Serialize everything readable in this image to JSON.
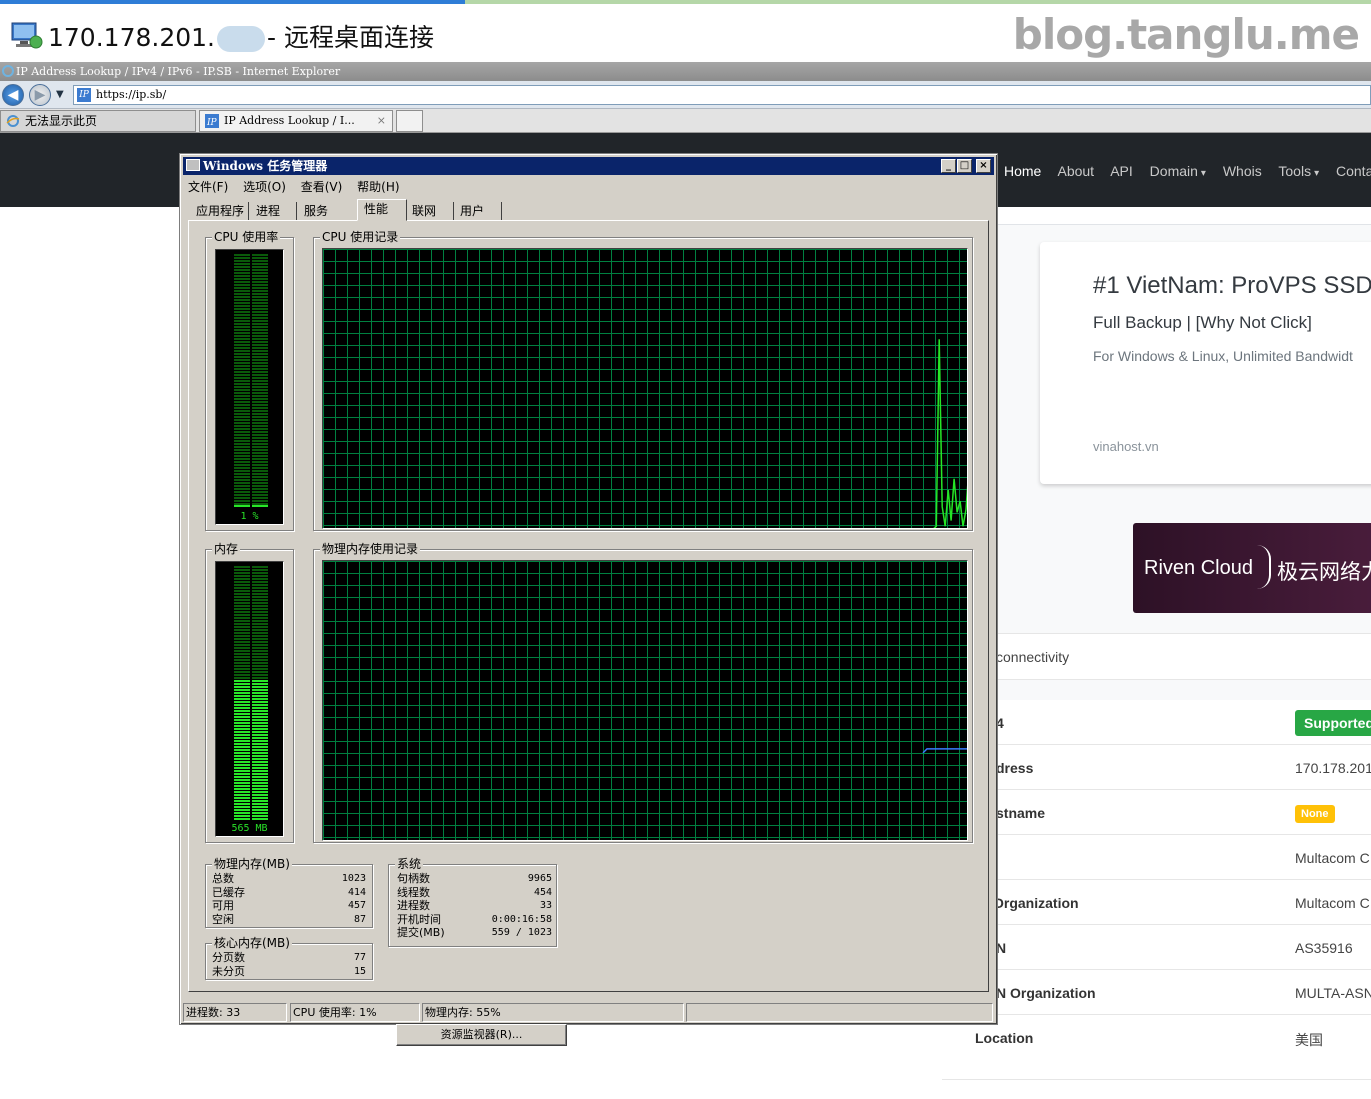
{
  "rdp": {
    "title_prefix": "170.178.201.",
    "title_suffix": "- 远程桌面连接",
    "watermark": "blog.tanglu.me"
  },
  "ie": {
    "window_title": "IP Address Lookup / IPv4 / IPv6 - IP.SB - Internet Explorer",
    "url": "https://ip.sb/",
    "tabs": [
      {
        "label": "无法显示此页"
      },
      {
        "label": "IP Address Lookup / I..."
      }
    ],
    "tab_close": "×"
  },
  "site": {
    "nav": [
      {
        "label": "Home",
        "active": true
      },
      {
        "label": "About"
      },
      {
        "label": "API"
      },
      {
        "label": "Domain",
        "dropdown": true
      },
      {
        "label": "Whois"
      },
      {
        "label": "Tools",
        "dropdown": true
      },
      {
        "label": "Conta"
      }
    ],
    "ad": {
      "title": "#1 VietNam: ProVPS SSD",
      "subtitle": "Full Backup | [Why Not Click]",
      "description": "For Windows & Linux, Unlimited Bandwidt",
      "domain": "vinahost.vn"
    },
    "banner": {
      "left": "Riven Cloud",
      "right": "极云网络力"
    },
    "connectivity_label": "connectivity",
    "rows": [
      {
        "label": "4",
        "value": "Supported",
        "type": "badge-ok"
      },
      {
        "label": "dress",
        "value": "170.178.201."
      },
      {
        "label": "stname",
        "value": "None",
        "type": "badge-none"
      },
      {
        "label": "",
        "value": "Multacom C"
      },
      {
        "label": "Organization",
        "value": "Multacom C"
      },
      {
        "label": "N",
        "value": "AS35916"
      },
      {
        "label": "N Organization",
        "value": "MULTA-ASN"
      },
      {
        "label": "Location",
        "value": "美国"
      }
    ]
  },
  "taskmgr": {
    "title": "Windows 任务管理器",
    "window_buttons": [
      "_",
      "□",
      "×"
    ],
    "menu": [
      "文件(F)",
      "选项(O)",
      "查看(V)",
      "帮助(H)"
    ],
    "tabs": [
      {
        "label": "应用程序"
      },
      {
        "label": "进程"
      },
      {
        "label": "服务"
      },
      {
        "label": "性能",
        "selected": true
      },
      {
        "label": "联网"
      },
      {
        "label": "用户"
      }
    ],
    "cpu_usage_label": "CPU 使用率",
    "cpu_usage_value": "1 %",
    "cpu_usage_fraction": 0.01,
    "cpu_history_label": "CPU 使用记录",
    "cpu_history": [
      0,
      0,
      0,
      0,
      0,
      0,
      0,
      0,
      0,
      0,
      0,
      0,
      0,
      0,
      0,
      0,
      0,
      0,
      0,
      0,
      0,
      0,
      0,
      0,
      0,
      0,
      0,
      0,
      0,
      0,
      0,
      0,
      0,
      0,
      0,
      0,
      0,
      0,
      0,
      0,
      0,
      0,
      0,
      0,
      0,
      0,
      0,
      0,
      0,
      0,
      0,
      0,
      0,
      0,
      0,
      0,
      0,
      0,
      0,
      0,
      0,
      0,
      0,
      0,
      0,
      0,
      0,
      0,
      0,
      0,
      0,
      0,
      0,
      0,
      0,
      0,
      0,
      0,
      0,
      0,
      0,
      0,
      0,
      0,
      0,
      0,
      0,
      0,
      0,
      0,
      0,
      0,
      0,
      0,
      0,
      0,
      0,
      0,
      0,
      0,
      0,
      0,
      0,
      0,
      0,
      0,
      0,
      0,
      0,
      0,
      0,
      0,
      0,
      0,
      0,
      0,
      0,
      0,
      0,
      0,
      0,
      0,
      0,
      0,
      0,
      0,
      0,
      0,
      0,
      0,
      0,
      0,
      0,
      0,
      0,
      0,
      0,
      0,
      0,
      0,
      0,
      0,
      0,
      0,
      0,
      0,
      0,
      0,
      0,
      0,
      0,
      0,
      0,
      0,
      0,
      0,
      0,
      0,
      0,
      0,
      0,
      0,
      0,
      0,
      0,
      0,
      0,
      0,
      0,
      0,
      0,
      0,
      0,
      0,
      0,
      0,
      0,
      0,
      0,
      0,
      0,
      0,
      0,
      0,
      0,
      0,
      0,
      0,
      0,
      0,
      0,
      0,
      0,
      0,
      0,
      0,
      0,
      0,
      0,
      0,
      0,
      0,
      0,
      0,
      0,
      0,
      1,
      68,
      8,
      1,
      14,
      3,
      18,
      6,
      10,
      1,
      7,
      22
    ],
    "memory_label": "内存",
    "memory_value": "565 MB",
    "memory_fraction": 0.55,
    "memory_history_label": "物理内存使用记录",
    "memory_history_level": 0.55,
    "physical_memory": {
      "title": "物理内存(MB)",
      "rows": [
        {
          "label": "总数",
          "value": "1023"
        },
        {
          "label": "已缓存",
          "value": "414"
        },
        {
          "label": "可用",
          "value": "457"
        },
        {
          "label": "空闲",
          "value": "87"
        }
      ]
    },
    "kernel_memory": {
      "title": "核心内存(MB)",
      "rows": [
        {
          "label": "分页数",
          "value": "77"
        },
        {
          "label": "未分页",
          "value": "15"
        }
      ]
    },
    "system": {
      "title": "系统",
      "rows": [
        {
          "label": "句柄数",
          "value": "9965"
        },
        {
          "label": "线程数",
          "value": "454"
        },
        {
          "label": "进程数",
          "value": "33"
        },
        {
          "label": "开机时间",
          "value": "0:00:16:58"
        },
        {
          "label": "提交(MB)",
          "value": "559 / 1023"
        }
      ]
    },
    "resource_monitor_button": "资源监视器(R)...",
    "status": {
      "processes": "进程数: 33",
      "cpu": "CPU 使用率: 1%",
      "memory": "物理内存: 55%"
    }
  }
}
